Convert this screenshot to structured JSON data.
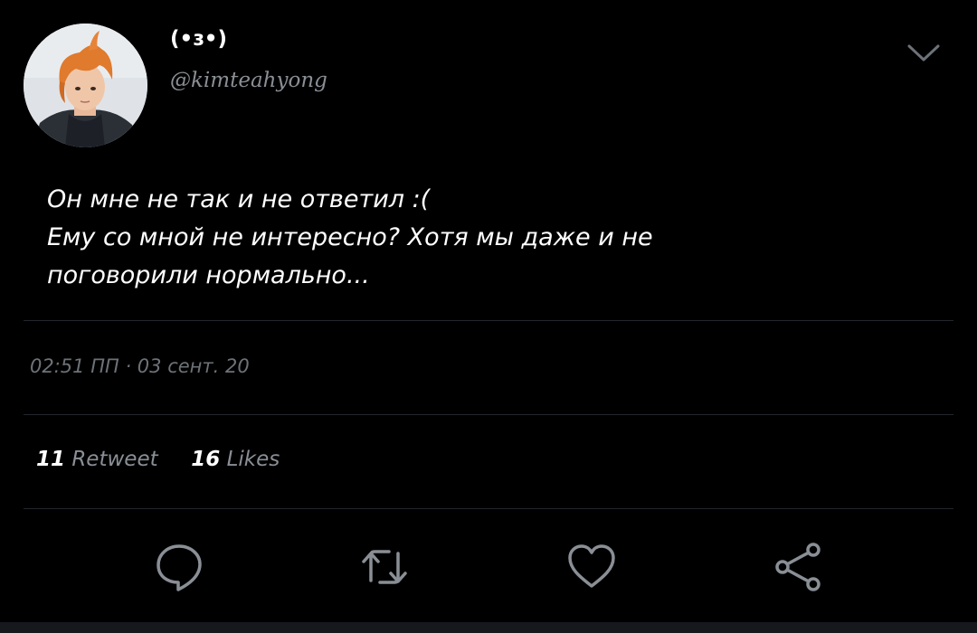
{
  "user": {
    "display_name": "(•ɜ•)",
    "handle": "@kimteahyong",
    "avatar_icon": "profile-photo"
  },
  "tweet": {
    "lines": [
      "Он мне не так и не ответил :(",
      "Ему со мной не интересно? Хотя мы даже и не",
      "поговорили нормально..."
    ],
    "timestamp": "02:51 ПП · 03 сент. 20"
  },
  "stats": {
    "retweets_count": "11",
    "retweets_label": "Retweet",
    "likes_count": "16",
    "likes_label": "Likes"
  },
  "actions": {
    "reply_icon": "speech-bubble-icon",
    "retweet_icon": "retweet-icon",
    "like_icon": "heart-icon",
    "share_icon": "share-icon",
    "menu_icon": "chevron-down-icon"
  },
  "colors": {
    "background": "#000000",
    "text": "#ffffff",
    "muted": "#8a8f96",
    "divider": "#22262b",
    "icon": "#8a8f96"
  }
}
